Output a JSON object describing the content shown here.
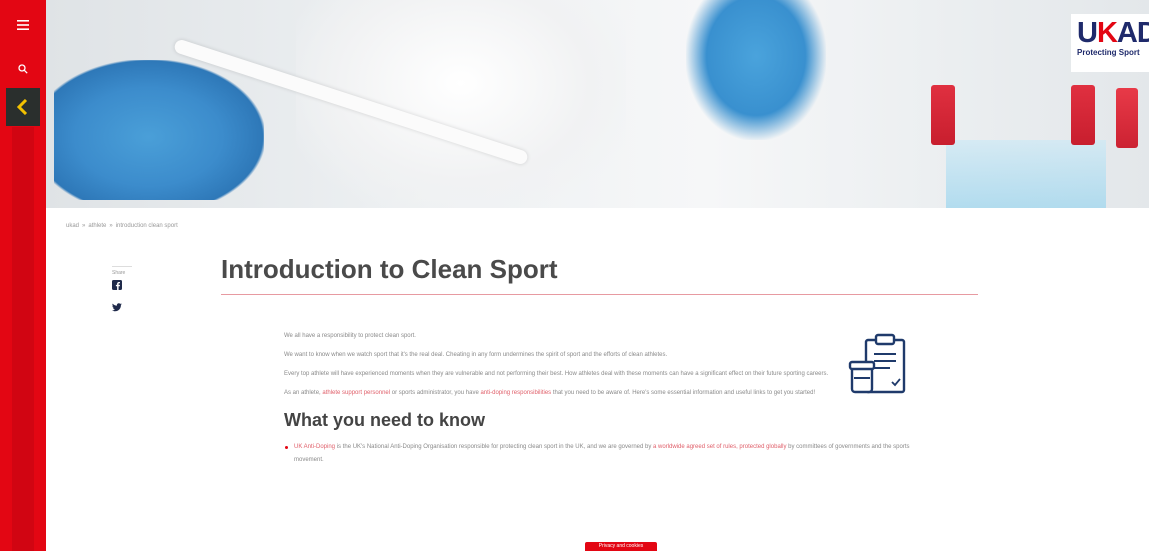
{
  "rail": {
    "menu_icon": "hamburger-menu-icon",
    "search_icon": "search-icon",
    "back_icon": "back-arrow-icon",
    "colors": {
      "rail": "#e30613",
      "back_bg": "#2a2f2d",
      "back_fg": "#f2c100"
    }
  },
  "logo": {
    "mark_u": "U",
    "mark_k": "K",
    "mark_ad": "AD",
    "tagline": "Protecting Sport"
  },
  "breadcrumb": {
    "items": [
      "ukad",
      "athlete",
      "introduction clean sport"
    ],
    "separator": "»"
  },
  "share": {
    "label": "Share",
    "facebook_icon": "facebook-icon",
    "twitter_icon": "twitter-icon"
  },
  "page": {
    "title": "Introduction to Clean Sport"
  },
  "intro": {
    "p1": "We all have a responsibility to protect clean sport.",
    "p2": "We want to know when we watch sport that it's the real deal. Cheating in any form undermines the spirit of sport and the efforts of clean athletes.",
    "p3": "Every top athlete will have experienced moments when they are vulnerable and not performing their best. How athletes deal with these moments can have a significant effect on their future sporting careers.",
    "p4_before": "As an athlete, ",
    "p4_link1": "athlete support personnel",
    "p4_middle": " or sports administrator, you have ",
    "p4_link2": "anti-doping responsibilities",
    "p4_after": " that you need to be aware of. Here's some essential information and useful links to get you started!"
  },
  "section": {
    "heading": "What you need to know",
    "bullet1_link": "UK Anti-Doping",
    "bullet1_text": " is the UK's National Anti-Doping Organisation responsible for protecting clean sport in the UK, and we are governed by ",
    "bullet1_link2": "a worldwide agreed set of rules, protected globally",
    "bullet1_text2": " by committees of governments and the sports movement."
  },
  "icons": {
    "clipboard": "clipboard-sample-icon"
  },
  "cookie": {
    "label": "Privacy and cookies"
  },
  "colors": {
    "accent": "#e30613",
    "link": "#e0606b",
    "title": "#4a4a4a",
    "icon_navy": "#1f3a6b"
  }
}
